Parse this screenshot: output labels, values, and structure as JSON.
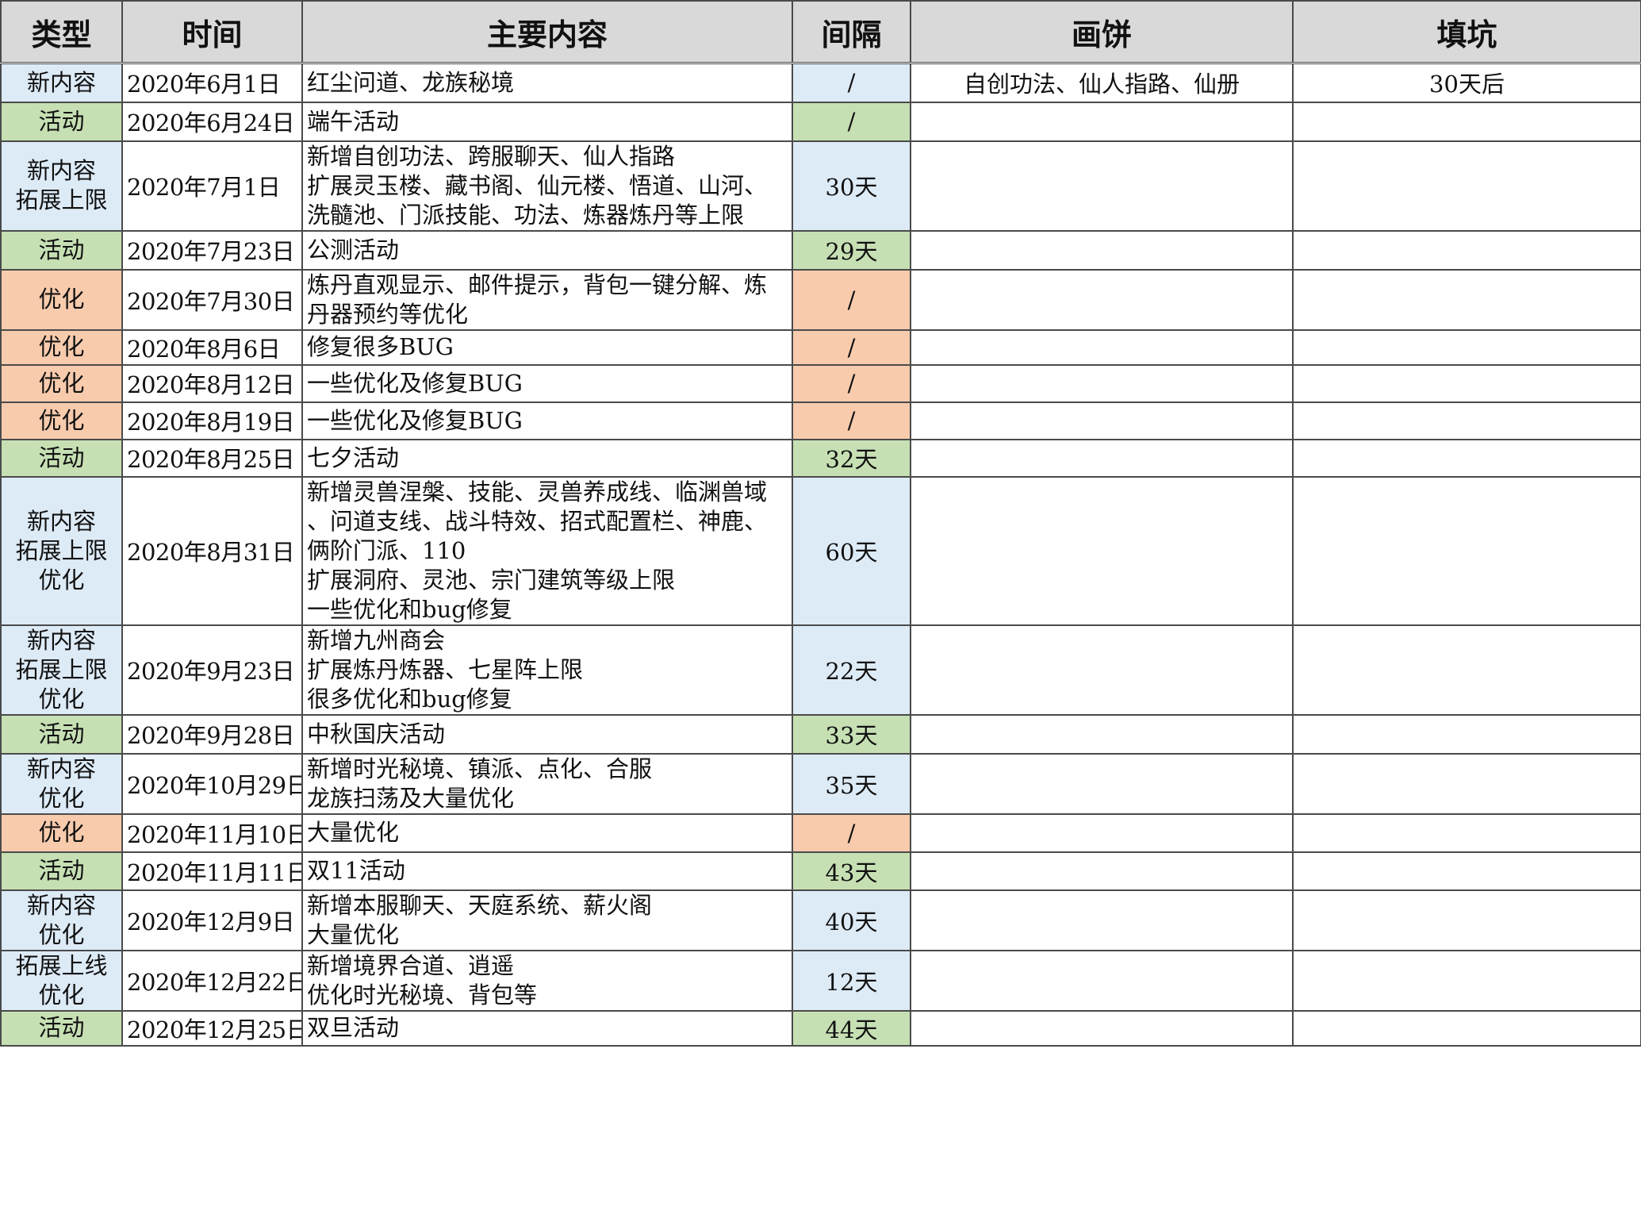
{
  "columns": [
    "类型",
    "时间",
    "主要内容",
    "间隔",
    "画饼",
    "填坑"
  ],
  "colors": {
    "blue": "#ddebf7",
    "green": "#c6e0b4",
    "orange": "#f8cbad",
    "header": "#d9d9d9"
  },
  "rows": [
    {
      "type": "新内容",
      "color": "blue",
      "time": "2020年6月1日",
      "content": "红尘问道、龙族秘境",
      "gap": "/",
      "pie": "自创功法、仙人指路、仙册",
      "fill": "30天后"
    },
    {
      "type": "活动",
      "color": "green",
      "time": "2020年6月24日",
      "content": "端午活动",
      "gap": "/",
      "pie": "",
      "fill": ""
    },
    {
      "type": "新内容\n拓展上限",
      "color": "blue",
      "time": "2020年7月1日",
      "content": "新增自创功法、跨服聊天、仙人指路\n扩展灵玉楼、藏书阁、仙元楼、悟道、山河、\n洗髓池、门派技能、功法、炼器炼丹等上限",
      "gap": "30天",
      "pie": "",
      "fill": ""
    },
    {
      "type": "活动",
      "color": "green",
      "time": "2020年7月23日",
      "content": "公测活动",
      "gap": "29天",
      "pie": "",
      "fill": ""
    },
    {
      "type": "优化",
      "color": "orange",
      "time": "2020年7月30日",
      "content": "炼丹直观显示、邮件提示，背包一键分解、炼\n丹器预约等优化",
      "gap": "/",
      "pie": "",
      "fill": ""
    },
    {
      "type": "优化",
      "color": "orange",
      "time": "2020年8月6日",
      "content": "修复很多BUG",
      "gap": "/",
      "pie": "",
      "fill": ""
    },
    {
      "type": "优化",
      "color": "orange",
      "time": "2020年8月12日",
      "content": "一些优化及修复BUG",
      "gap": "/",
      "pie": "",
      "fill": ""
    },
    {
      "type": "优化",
      "color": "orange",
      "time": "2020年8月19日",
      "content": "一些优化及修复BUG",
      "gap": "/",
      "pie": "",
      "fill": ""
    },
    {
      "type": "活动",
      "color": "green",
      "time": "2020年8月25日",
      "content": "七夕活动",
      "gap": "32天",
      "pie": "",
      "fill": ""
    },
    {
      "type": "新内容\n拓展上限\n优化",
      "color": "blue",
      "time": "2020年8月31日",
      "content": "新增灵兽涅槃、技能、灵兽养成线、临渊兽域\n、问道支线、战斗特效、招式配置栏、神鹿、\n俩阶门派、110\n扩展洞府、灵池、宗门建筑等级上限\n一些优化和bug修复",
      "gap": "60天",
      "pie": "",
      "fill": ""
    },
    {
      "type": "新内容\n拓展上限\n优化",
      "color": "blue",
      "time": "2020年9月23日",
      "content": "新增九州商会\n扩展炼丹炼器、七星阵上限\n很多优化和bug修复",
      "gap": "22天",
      "pie": "",
      "fill": ""
    },
    {
      "type": "活动",
      "color": "green",
      "time": "2020年9月28日",
      "content": "中秋国庆活动",
      "gap": "33天",
      "pie": "",
      "fill": ""
    },
    {
      "type": "新内容\n优化",
      "color": "blue",
      "time": "2020年10月29日",
      "content": "新增时光秘境、镇派、点化、合服\n龙族扫荡及大量优化",
      "gap": "35天",
      "pie": "",
      "fill": ""
    },
    {
      "type": "优化",
      "color": "orange",
      "time": "2020年11月10日",
      "content": "大量优化",
      "gap": "/",
      "pie": "",
      "fill": ""
    },
    {
      "type": "活动",
      "color": "green",
      "time": "2020年11月11日",
      "content": "双11活动",
      "gap": "43天",
      "pie": "",
      "fill": ""
    },
    {
      "type": "新内容\n优化",
      "color": "blue",
      "time": "2020年12月9日",
      "content": "新增本服聊天、天庭系统、薪火阁\n大量优化",
      "gap": "40天",
      "pie": "",
      "fill": ""
    },
    {
      "type": "拓展上线\n优化",
      "color": "blue",
      "time": "2020年12月22日",
      "content": "新增境界合道、逍遥\n优化时光秘境、背包等",
      "gap": "12天",
      "pie": "",
      "fill": ""
    },
    {
      "type": "活动",
      "color": "green",
      "time": "2020年12月25日",
      "content": "双旦活动",
      "gap": "44天",
      "pie": "",
      "fill": ""
    }
  ]
}
